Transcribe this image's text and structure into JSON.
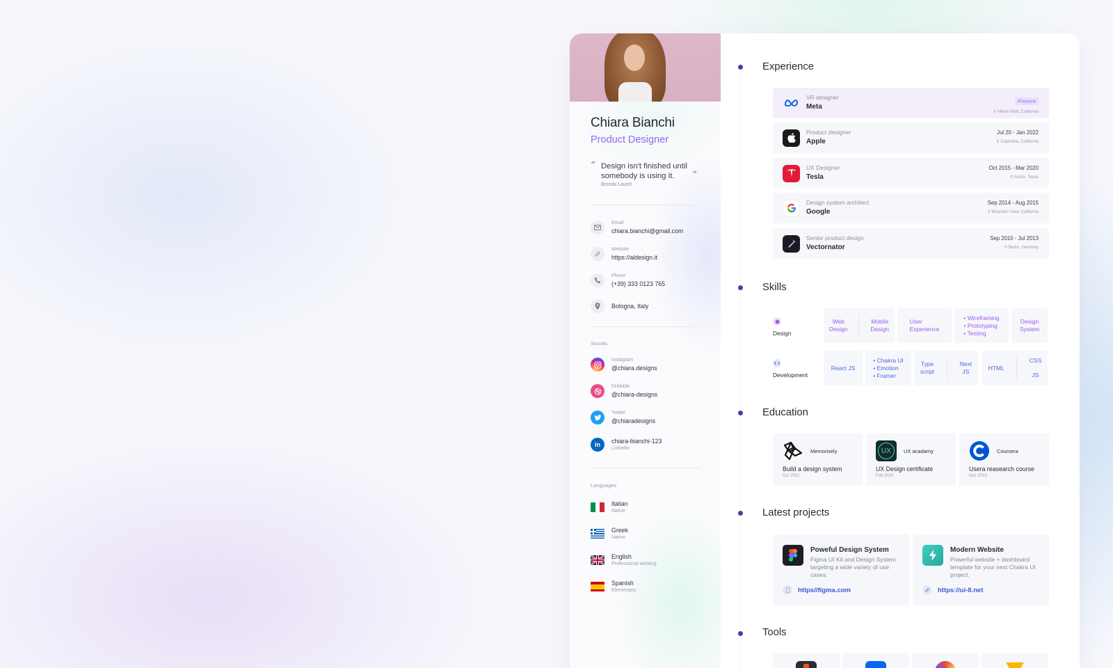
{
  "profile": {
    "name": "Chiara Bianchi",
    "role": "Product Designer",
    "quote": "Design isn't finished until somebody is using it.",
    "quote_author": "Brenda Laurel"
  },
  "contact": {
    "email_label": "Email",
    "email": "chiara.bianchi@gmail.com",
    "website_label": "Website",
    "website": "https://aldesign.it",
    "phone_label": "Phone",
    "phone": "(+39) 333 0123 765",
    "location": "Bologna, Italy"
  },
  "socials": {
    "title": "Socials",
    "items": [
      {
        "label": "Instagram",
        "handle": "@chiara.designs",
        "icon": "instagram-icon",
        "color": "#e1306c"
      },
      {
        "label": "Dribbble",
        "handle": "@chiara-designs",
        "icon": "dribbble-icon",
        "color": "#ea4c89"
      },
      {
        "label": "Twitter",
        "handle": "@chiaradesigns",
        "icon": "twitter-icon",
        "color": "#1da1f2"
      },
      {
        "label": "Linkedin",
        "handle": "chiara-bianchi-123",
        "icon": "linkedin-icon",
        "color": "#0a66c2"
      }
    ]
  },
  "languages": {
    "title": "Languages",
    "items": [
      {
        "name": "Italian",
        "level": "Native"
      },
      {
        "name": "Greek",
        "level": "Native"
      },
      {
        "name": "English",
        "level": "Professional working"
      },
      {
        "name": "Spanish",
        "level": "Elementary"
      }
    ]
  },
  "experience": {
    "title": "Experience",
    "items": [
      {
        "role": "VR designer",
        "company": "Meta",
        "date": "Present",
        "location": "Menlo Park, California"
      },
      {
        "role": "Product designer",
        "company": "Apple",
        "date": "Jul 20 - Jan 2022",
        "location": "Cupertino, California"
      },
      {
        "role": "UX Designer",
        "company": "Tesla",
        "date": "Oct 2015 - Mar 2020",
        "location": "Austin, Texas"
      },
      {
        "role": "Design system architect",
        "company": "Google",
        "date": "Sep 2014 - Aug 2015",
        "location": "Mountain View, California"
      },
      {
        "role": "Senior product design",
        "company": "Vectornator",
        "date": "Sep 2010 - Jul 2013",
        "location": "Berlin, Germany"
      }
    ]
  },
  "skills": {
    "title": "Skills",
    "design": {
      "label": "Design",
      "web": "Web Design",
      "web_l1": "Web",
      "web_l2": "Design",
      "mob_l1": "Mobile",
      "mob_l2": "Design",
      "ux_l1": "User",
      "ux_l2": "Experience",
      "bullets": [
        "Wireframing",
        "Prototyping",
        "Testing"
      ],
      "ds_l1": "Design",
      "ds_l2": "System"
    },
    "development": {
      "label": "Development",
      "react": "React JS",
      "bullets": [
        "Chakra UI",
        "Emotion",
        "Framer"
      ],
      "ts_l1": "Type",
      "ts_l2": "script",
      "next_l1": "Next",
      "next_l2": "JS",
      "html": "HTML",
      "css": "CSS",
      "js": "JS"
    }
  },
  "education": {
    "title": "Education",
    "items": [
      {
        "org": "Memorisely",
        "title": "Build a design system",
        "date": "Oct 2021"
      },
      {
        "org": "UX acadamy",
        "title": "UX Design certificate",
        "date": "Feb 2020"
      },
      {
        "org": "Coursera",
        "title": "Usera reasearch course",
        "date": "Dec 2019"
      }
    ]
  },
  "projects": {
    "title": "Latest projects",
    "items": [
      {
        "title": "Poweful Design System",
        "desc": "Figma UI Kit and Design System targeting a wide variety of use cases.",
        "link": "https//figma.com"
      },
      {
        "title": "Modern Website",
        "desc": "Powerful website + dashboard template for your next Chakra UI project.",
        "link": "https://ui-8.net"
      }
    ]
  },
  "tools": {
    "title": "Tools"
  },
  "colors": {
    "accent": "#8a6ae8",
    "timeline_dot": "#4b3bb0",
    "link": "#3d5ad6"
  }
}
